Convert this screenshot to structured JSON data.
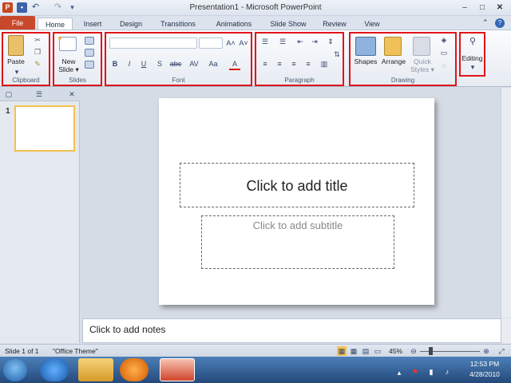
{
  "window": {
    "title": "Presentation1 - Microsoft PowerPoint",
    "app_letter": "P",
    "min": "–",
    "max": "□",
    "close": "✕"
  },
  "quick_access": {
    "undo": "↶",
    "redo": "↷",
    "more": "▾"
  },
  "tabs": [
    "File",
    "Home",
    "Insert",
    "Design",
    "Transitions",
    "Animations",
    "Slide Show",
    "Review",
    "View"
  ],
  "help": "?",
  "ribbon": {
    "groups": {
      "clipboard": {
        "label": "Clipboard",
        "paste": "Paste"
      },
      "slides": {
        "label": "Slides",
        "new_slide_1": "New",
        "new_slide_2": "Slide ▾"
      },
      "font": {
        "label": "Font",
        "grow": "A˄",
        "shrink": "A˅",
        "bold": "B",
        "italic": "I",
        "underline": "U",
        "strike": "S",
        "shadow": "abc",
        "spacing": "AV",
        "case": "Aa",
        "color": "A"
      },
      "paragraph": {
        "label": "Paragraph"
      },
      "drawing": {
        "label": "Drawing",
        "shapes": "Shapes",
        "arrange": "Arrange",
        "quick_styles_1": "Quick",
        "quick_styles_2": "Styles ▾"
      },
      "editing": {
        "label": "Editing"
      }
    }
  },
  "slides_pane": {
    "thumb_number": "1"
  },
  "slide": {
    "title_placeholder": "Click to add title",
    "subtitle_placeholder": "Click to add subtitle"
  },
  "notes": {
    "placeholder": "Click to add notes"
  },
  "status": {
    "slide_counter": "Slide 1 of 1",
    "theme": "\"Office Theme\"",
    "zoom": "45%"
  },
  "taskbar": {
    "time": "12:53 PM",
    "date": "4/28/2010"
  },
  "colors": {
    "file_tab": "#c7482b",
    "highlight_box": "#e0141a",
    "thumb_border": "#f3c14f"
  }
}
